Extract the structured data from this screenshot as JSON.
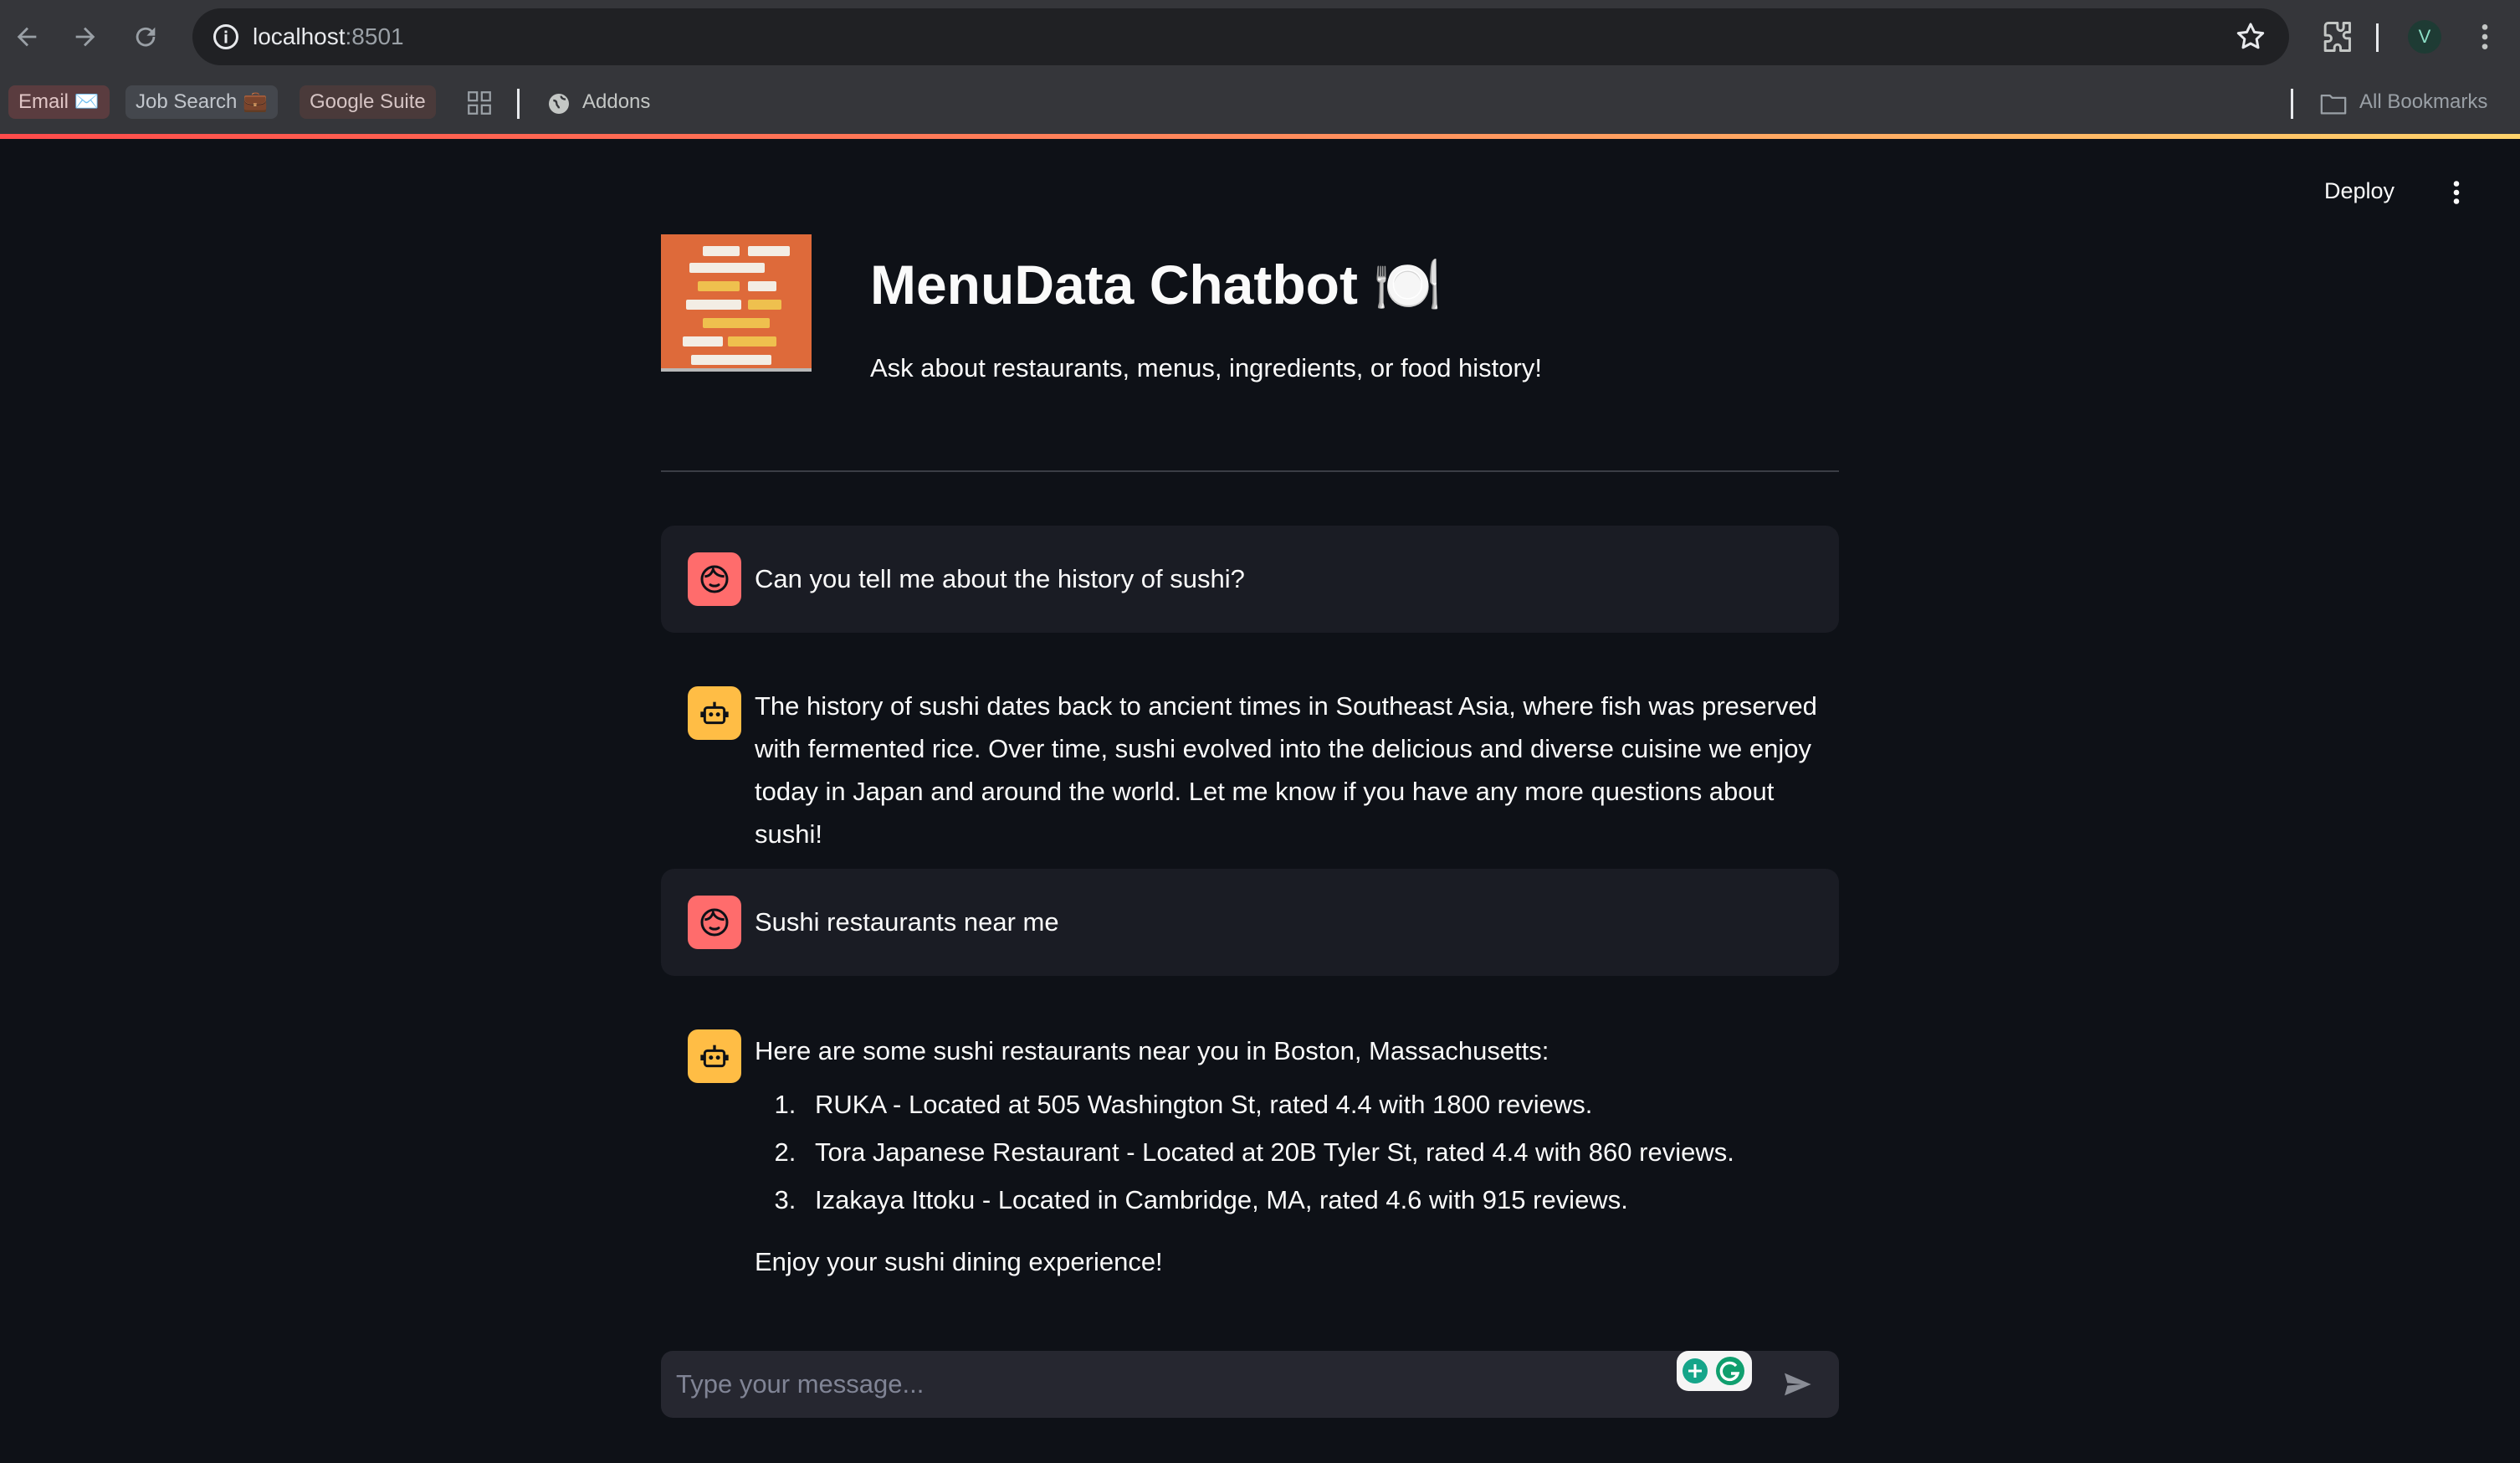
{
  "browser": {
    "url_host": "localhost",
    "url_port": ":8501",
    "profile_initial": "V",
    "bookmarks": {
      "email": "Email ✉️",
      "job_search": "Job Search 💼",
      "google_suite": "Google Suite",
      "addons": "Addons",
      "all_bookmarks": "All Bookmarks"
    }
  },
  "header": {
    "deploy_label": "Deploy"
  },
  "app": {
    "title": "MenuData Chatbot",
    "title_emoji": "🍽️",
    "subtitle": "Ask about restaurants, menus, ingredients, or food history!",
    "logo_colors": {
      "background": "#de6a3a",
      "cream": "#f3ede4",
      "gold": "#efc04e"
    }
  },
  "messages": [
    {
      "role": "user",
      "text": "Can you tell me about the history of sushi?"
    },
    {
      "role": "assistant",
      "text": "The history of sushi dates back to ancient times in Southeast Asia, where fish was preserved with fermented rice. Over time, sushi evolved into the delicious and diverse cuisine we enjoy today in Japan and around the world. Let me know if you have any more questions about sushi!"
    },
    {
      "role": "user",
      "text": "Sushi restaurants near me"
    },
    {
      "role": "assistant",
      "intro": "Here are some sushi restaurants near you in Boston, Massachusetts:",
      "items": [
        "RUKA - Located at 505 Washington St, rated 4.4 with 1800 reviews.",
        "Tora Japanese Restaurant - Located at 20B Tyler St, rated 4.4 with 860 reviews.",
        "Izakaya Ittoku - Located in Cambridge, MA, rated 4.6 with 915 reviews."
      ],
      "outro": "Enjoy your sushi dining experience!"
    }
  ],
  "chat_input": {
    "placeholder": "Type your message..."
  },
  "colors": {
    "app_background": "#0e1117",
    "user_avatar": "#ff6c6c",
    "assistant_avatar": "#ffbd45",
    "user_message_background": "#1a1c24"
  }
}
